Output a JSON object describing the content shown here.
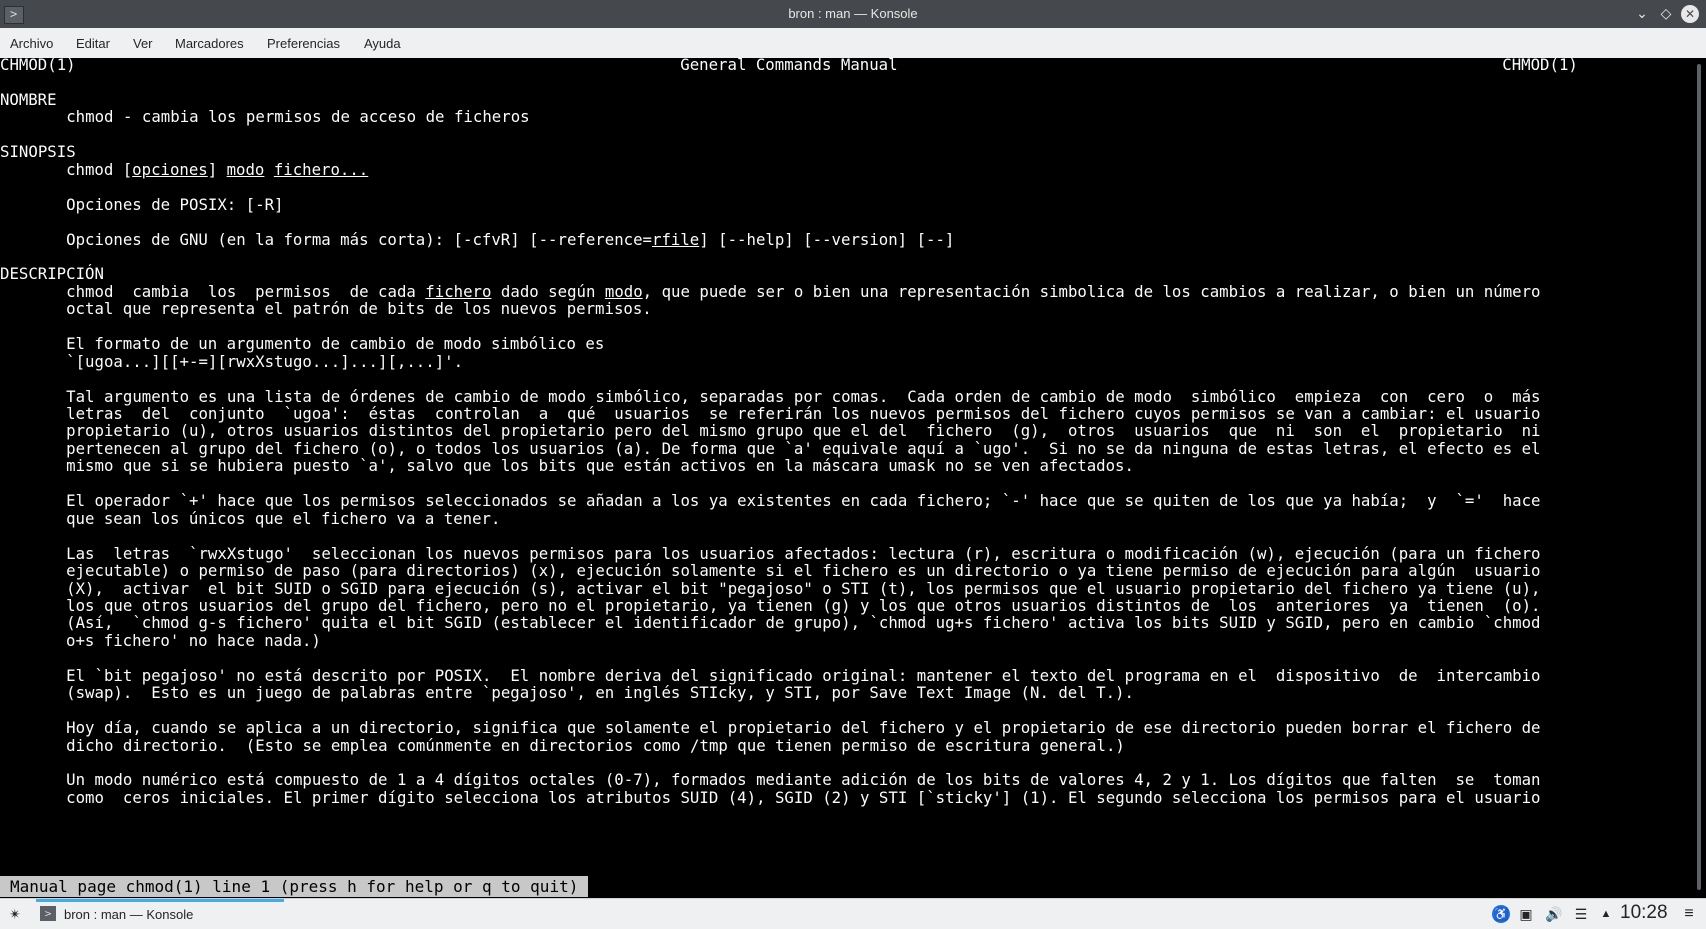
{
  "window": {
    "title": "bron : man — Konsole"
  },
  "menubar": {
    "items": [
      "Archivo",
      "Editar",
      "Ver",
      "Marcadores",
      "Preferencias",
      "Ayuda"
    ]
  },
  "terminal": {
    "lines": [
      [
        {
          "t": "CHMOD(1)                                                                General Commands Manual                                                                CHMOD(1)"
        }
      ],
      [],
      [
        {
          "t": "NOMBRE"
        }
      ],
      [
        {
          "t": "       chmod - cambia los permisos de acceso de ficheros"
        }
      ],
      [],
      [
        {
          "t": "SINOPSIS"
        }
      ],
      [
        {
          "t": "       chmod ["
        },
        {
          "t": "opciones",
          "u": true
        },
        {
          "t": "] "
        },
        {
          "t": "modo",
          "u": true
        },
        {
          "t": " "
        },
        {
          "t": "fichero...",
          "u": true
        }
      ],
      [],
      [
        {
          "t": "       Opciones de POSIX: [-R]"
        }
      ],
      [],
      [
        {
          "t": "       Opciones de GNU (en la forma más corta): [-cfvR] [--reference="
        },
        {
          "t": "rfile",
          "u": true
        },
        {
          "t": "] [--help] [--version] [--]"
        }
      ],
      [],
      [
        {
          "t": "DESCRIPCIÓN"
        }
      ],
      [
        {
          "t": "       chmod  cambia  los  permisos  de cada "
        },
        {
          "t": "fichero",
          "u": true
        },
        {
          "t": " dado según "
        },
        {
          "t": "modo",
          "u": true
        },
        {
          "t": ", que puede ser o bien una representación simbolica de los cambios a realizar, o bien un número"
        }
      ],
      [
        {
          "t": "       octal que representa el patrón de bits de los nuevos permisos."
        }
      ],
      [],
      [
        {
          "t": "       El formato de un argumento de cambio de modo simbólico es"
        }
      ],
      [
        {
          "t": "       `[ugoa...][[+-=][rwxXstugo...]...][,...]'."
        }
      ],
      [],
      [
        {
          "t": "       Tal argumento es una lista de órdenes de cambio de modo simbólico, separadas por comas.  Cada orden de cambio de modo  simbólico  empieza  con  cero  o  más"
        }
      ],
      [
        {
          "t": "       letras  del  conjunto  `ugoa':  éstas  controlan  a  qué  usuarios  se referirán los nuevos permisos del fichero cuyos permisos se van a cambiar: el usuario"
        }
      ],
      [
        {
          "t": "       propietario (u), otros usuarios distintos del propietario pero del mismo grupo que el del  fichero  (g),  otros  usuarios  que  ni  son  el  propietario  ni"
        }
      ],
      [
        {
          "t": "       pertenecen al grupo del fichero (o), o todos los usuarios (a). De forma que `a' equivale aquí a `ugo'.  Si no se da ninguna de estas letras, el efecto es el"
        }
      ],
      [
        {
          "t": "       mismo que si se hubiera puesto `a', salvo que los bits que están activos en la máscara umask no se ven afectados."
        }
      ],
      [],
      [
        {
          "t": "       El operador `+' hace que los permisos seleccionados se añadan a los ya existentes en cada fichero; `-' hace que se quiten de los que ya había;  y  `='  hace"
        }
      ],
      [
        {
          "t": "       que sean los únicos que el fichero va a tener."
        }
      ],
      [],
      [
        {
          "t": "       Las  letras  `rwxXstugo'  seleccionan los nuevos permisos para los usuarios afectados: lectura (r), escritura o modificación (w), ejecución (para un fichero"
        }
      ],
      [
        {
          "t": "       ejecutable) o permiso de paso (para directorios) (x), ejecución solamente si el fichero es un directorio o ya tiene permiso de ejecución para algún  usuario"
        }
      ],
      [
        {
          "t": "       (X),  activar  el bit SUID o SGID para ejecución (s), activar el bit \"pegajoso\" o STI (t), los permisos que el usuario propietario del fichero ya tiene (u),"
        }
      ],
      [
        {
          "t": "       los que otros usuarios del grupo del fichero, pero no el propietario, ya tienen (g) y los que otros usuarios distintos de  los  anteriores  ya  tienen  (o)."
        }
      ],
      [
        {
          "t": "       (Así,  `chmod g-s fichero' quita el bit SGID (establecer el identificador de grupo), `chmod ug+s fichero' activa los bits SUID y SGID, pero en cambio `chmod"
        }
      ],
      [
        {
          "t": "       o+s fichero' no hace nada.)"
        }
      ],
      [],
      [
        {
          "t": "       El `bit pegajoso' no está descrito por POSIX.  El nombre deriva del significado original: mantener el texto del programa en el  dispositivo  de  intercambio"
        }
      ],
      [
        {
          "t": "       (swap).  Esto es un juego de palabras entre `pegajoso', en inglés STIcky, y STI, por Save Text Image (N. del T.)."
        }
      ],
      [],
      [
        {
          "t": "       Hoy día, cuando se aplica a un directorio, significa que solamente el propietario del fichero y el propietario de ese directorio pueden borrar el fichero de"
        }
      ],
      [
        {
          "t": "       dicho directorio.  (Esto se emplea comúnmente en directorios como /tmp que tienen permiso de escritura general.)"
        }
      ],
      [],
      [
        {
          "t": "       Un modo numérico está compuesto de 1 a 4 dígitos octales (0-7), formados mediante adición de los bits de valores 4, 2 y 1. Los dígitos que falten  se  toman"
        }
      ],
      [
        {
          "t": "       como  ceros iniciales. El primer dígito selecciona los atributos SUID (4), SGID (2) y STI [`sticky'] (1). El segundo selecciona los permisos para el usuario"
        }
      ]
    ],
    "statusline": "Manual page chmod(1) line 1 (press h for help or q to quit)"
  },
  "taskbar": {
    "task_label": "bron : man — Konsole",
    "clock": "10:28"
  }
}
